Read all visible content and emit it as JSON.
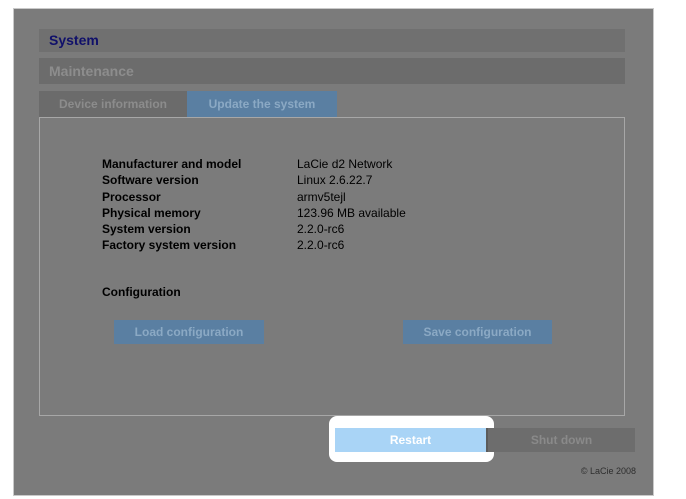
{
  "header": {
    "section_title": "System",
    "subsection_title": "Maintenance"
  },
  "tabs": [
    {
      "label": "Device information",
      "active": false
    },
    {
      "label": "Update the system",
      "active": true
    }
  ],
  "device_info": [
    {
      "key": "Manufacturer and model",
      "value": "LaCie d2 Network"
    },
    {
      "key": "Software version",
      "value": "Linux 2.6.22.7"
    },
    {
      "key": "Processor",
      "value": "armv5tejl"
    },
    {
      "key": "Physical memory",
      "value": "123.96 MB available"
    },
    {
      "key": "System version",
      "value": "2.2.0-rc6"
    },
    {
      "key": "Factory system version",
      "value": "2.2.0-rc6"
    }
  ],
  "configuration": {
    "label": "Configuration",
    "load_label": "Load configuration",
    "save_label": "Save configuration"
  },
  "actions": {
    "restart_label": "Restart",
    "shutdown_label": "Shut down"
  },
  "footer": {
    "copyright": "© LaCie 2008"
  },
  "colors": {
    "overlay_gray": "#7b7b7b",
    "section_title": "#10106a",
    "active_tab": "#5a7fa2",
    "restart_highlight": "#a9d4f6"
  }
}
